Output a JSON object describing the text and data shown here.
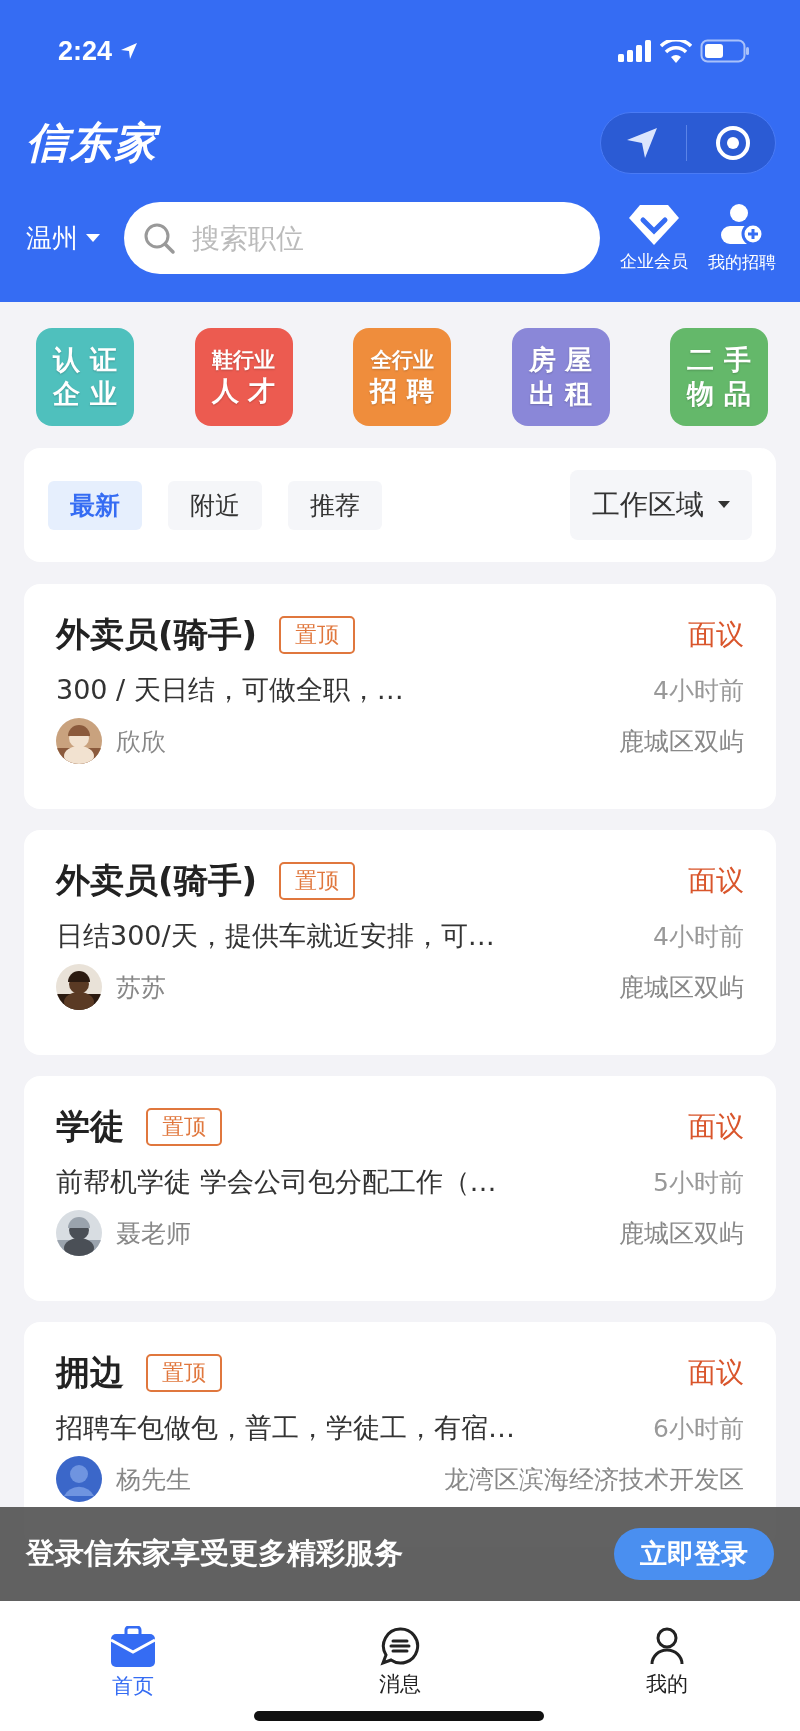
{
  "status_bar": {
    "time": "2:24"
  },
  "header": {
    "logo": "信东家",
    "city": "温州",
    "search": {
      "placeholder": "搜索职位"
    },
    "actions": [
      {
        "label": "企业会员",
        "kind": "vip"
      },
      {
        "label": "我的招聘",
        "kind": "recruit"
      }
    ]
  },
  "categories": [
    {
      "line1": "认 证",
      "line2": "企 业",
      "color": "#4fc0bd"
    },
    {
      "line1": "鞋行业",
      "line2": "人 才",
      "color": "#ec5b50"
    },
    {
      "line1": "全行业",
      "line2": "招 聘",
      "color": "#ef8d3c"
    },
    {
      "line1": "房 屋",
      "line2": "出 租",
      "color": "#8a87d8"
    },
    {
      "line1": "二 手",
      "line2": "物 品",
      "color": "#64b86a"
    }
  ],
  "filters": [
    {
      "label": "最新",
      "selected": true
    },
    {
      "label": "附近",
      "selected": false
    },
    {
      "label": "推荐",
      "selected": false
    }
  ],
  "area_dropdown": "工作区域",
  "jobs": [
    {
      "title": "外卖员(骑手)",
      "tag": "置顶",
      "salary": "面议",
      "desc": "300 / 天日结，可做全职，…",
      "time": "4小时前",
      "poster": "欣欣",
      "location": "鹿城区双屿"
    },
    {
      "title": "外卖员(骑手)",
      "tag": "置顶",
      "salary": "面议",
      "desc": "日结300/天，提供车就近安排，可…",
      "time": "4小时前",
      "poster": "苏苏",
      "location": "鹿城区双屿"
    },
    {
      "title": "学徒",
      "tag": "置顶",
      "salary": "面议",
      "desc": "前帮机学徒 学会公司包分配工作（…",
      "time": "5小时前",
      "poster": "聂老师",
      "location": "鹿城区双屿"
    },
    {
      "title": "拥边",
      "tag": "置顶",
      "salary": "面议",
      "desc": "招聘车包做包，普工，学徒工，有宿…",
      "time": "6小时前",
      "poster": "杨先生",
      "location": "龙湾区滨海经济技术开发区",
      "avatar": {
        "kind": "default"
      }
    }
  ],
  "login_banner": {
    "text": "登录信东家享受更多精彩服务",
    "button": "立即登录"
  },
  "tab_bar": [
    {
      "label": "首页",
      "kind": "home",
      "selected": true
    },
    {
      "label": "消息",
      "kind": "message",
      "selected": false
    },
    {
      "label": "我的",
      "kind": "profile",
      "selected": false
    }
  ]
}
